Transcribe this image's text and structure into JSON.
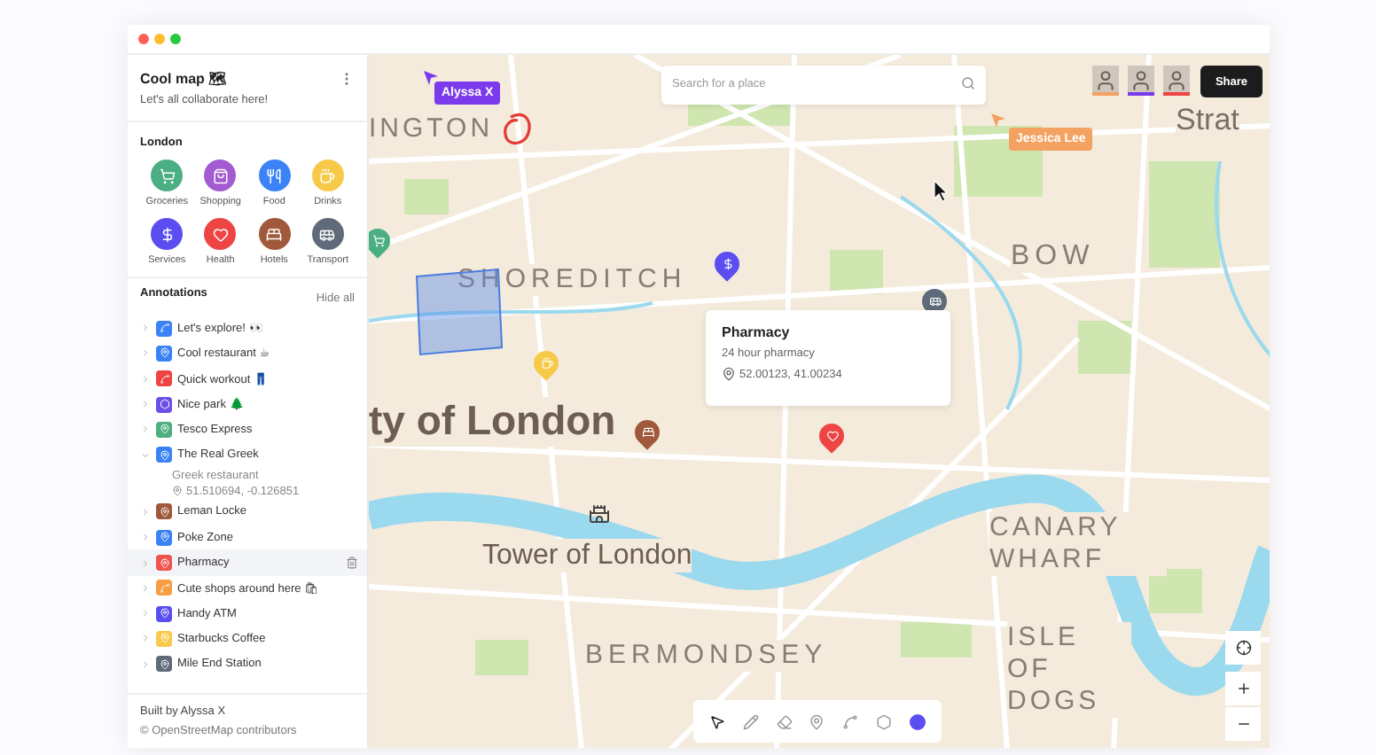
{
  "sidebar": {
    "title": "Cool map 🗺",
    "subtitle": "Let's all collaborate here!",
    "section": "London",
    "categories": [
      {
        "label": "Groceries",
        "kind": "groceries",
        "color": "#4caf84"
      },
      {
        "label": "Shopping",
        "kind": "shopping",
        "color": "#a25bd0"
      },
      {
        "label": "Food",
        "kind": "food",
        "color": "#3b82f6"
      },
      {
        "label": "Drinks",
        "kind": "drinks",
        "color": "#f7c948"
      },
      {
        "label": "Services",
        "kind": "services",
        "color": "#5b4ef0"
      },
      {
        "label": "Health",
        "kind": "health",
        "color": "#ef4444"
      },
      {
        "label": "Hotels",
        "kind": "hotels",
        "color": "#a0593a"
      },
      {
        "label": "Transport",
        "kind": "transport",
        "color": "#5f6b7a"
      }
    ],
    "annotations_title": "Annotations",
    "hide_all": "Hide all",
    "annotations": [
      {
        "label": "Let's explore! 👀",
        "kind": "line",
        "color": "#3b82f6",
        "expanded": false,
        "selected": false
      },
      {
        "label": "Cool restaurant ☕",
        "kind": "marker",
        "color": "#3b82f6",
        "expanded": false,
        "selected": false
      },
      {
        "label": "Quick workout 👖",
        "kind": "line",
        "color": "#ef4444",
        "expanded": false,
        "selected": false
      },
      {
        "label": "Nice park 🌲",
        "kind": "area",
        "color": "#6d4ee8",
        "expanded": false,
        "selected": false
      },
      {
        "label": "Tesco Express",
        "kind": "marker",
        "color": "#4caf7d",
        "expanded": false,
        "selected": false
      },
      {
        "label": "The Real Greek",
        "kind": "marker",
        "color": "#3b82f6",
        "expanded": true,
        "selected": false,
        "description": "Greek restaurant",
        "coordinates": "51.510694, -0.126851"
      },
      {
        "label": "Leman Locke",
        "kind": "marker",
        "color": "#a0593a",
        "expanded": false,
        "selected": false
      },
      {
        "label": "Poke Zone",
        "kind": "marker",
        "color": "#3b82f6",
        "expanded": false,
        "selected": false
      },
      {
        "label": "Pharmacy",
        "kind": "marker",
        "color": "#ef5350",
        "expanded": false,
        "selected": true
      },
      {
        "label": "Cute shops around here 🛍",
        "kind": "line",
        "color": "#f59e42",
        "expanded": false,
        "selected": false
      },
      {
        "label": "Handy ATM",
        "kind": "marker",
        "color": "#5b4ef0",
        "expanded": false,
        "selected": false
      },
      {
        "label": "Starbucks Coffee",
        "kind": "marker",
        "color": "#f8c94c",
        "expanded": false,
        "selected": false
      },
      {
        "label": "Mile End Station",
        "kind": "marker",
        "color": "#5f6b7a",
        "expanded": false,
        "selected": false
      }
    ],
    "footer": {
      "credit": "Built by Alyssa X",
      "attribution": "© OpenStreetMap contributors"
    }
  },
  "map": {
    "search": {
      "placeholder": "Search for a place"
    },
    "collaborators": [
      {
        "color": "#f4a261"
      },
      {
        "color": "#7c3aed"
      },
      {
        "color": "#ef4444"
      }
    ],
    "share": "Share",
    "cursors": [
      {
        "name": "Alyssa X",
        "color": "#7c3aed"
      },
      {
        "name": "Jessica Lee",
        "color": "#f4a261"
      }
    ],
    "labels": [
      "INGTON",
      "SHOREDITCH",
      "BOW",
      "ty of London",
      "Tower of London",
      "CANARY WHARF",
      "ISLE OF DOGS",
      "BERMONDSEY",
      "Strat"
    ],
    "markers": [
      {
        "kind": "groceries",
        "color": "#4caf84"
      },
      {
        "kind": "services",
        "color": "#5b4ef0"
      },
      {
        "kind": "transport",
        "color": "#5f6b7a"
      },
      {
        "kind": "drinks",
        "color": "#f7c948"
      },
      {
        "kind": "hotels",
        "color": "#a0593a"
      },
      {
        "kind": "health",
        "color": "#ef4444"
      }
    ],
    "popup": {
      "title": "Pharmacy",
      "description": "24 hour pharmacy",
      "coordinates": "52.00123, 41.00234"
    },
    "tools": [
      {
        "kind": "select",
        "selected": true
      },
      {
        "kind": "pen",
        "selected": false
      },
      {
        "kind": "eraser",
        "selected": false
      },
      {
        "kind": "marker",
        "selected": false
      },
      {
        "kind": "line",
        "selected": false
      },
      {
        "kind": "area",
        "selected": false
      }
    ],
    "color_swatch": {
      "color": "#5b4ef0"
    }
  }
}
